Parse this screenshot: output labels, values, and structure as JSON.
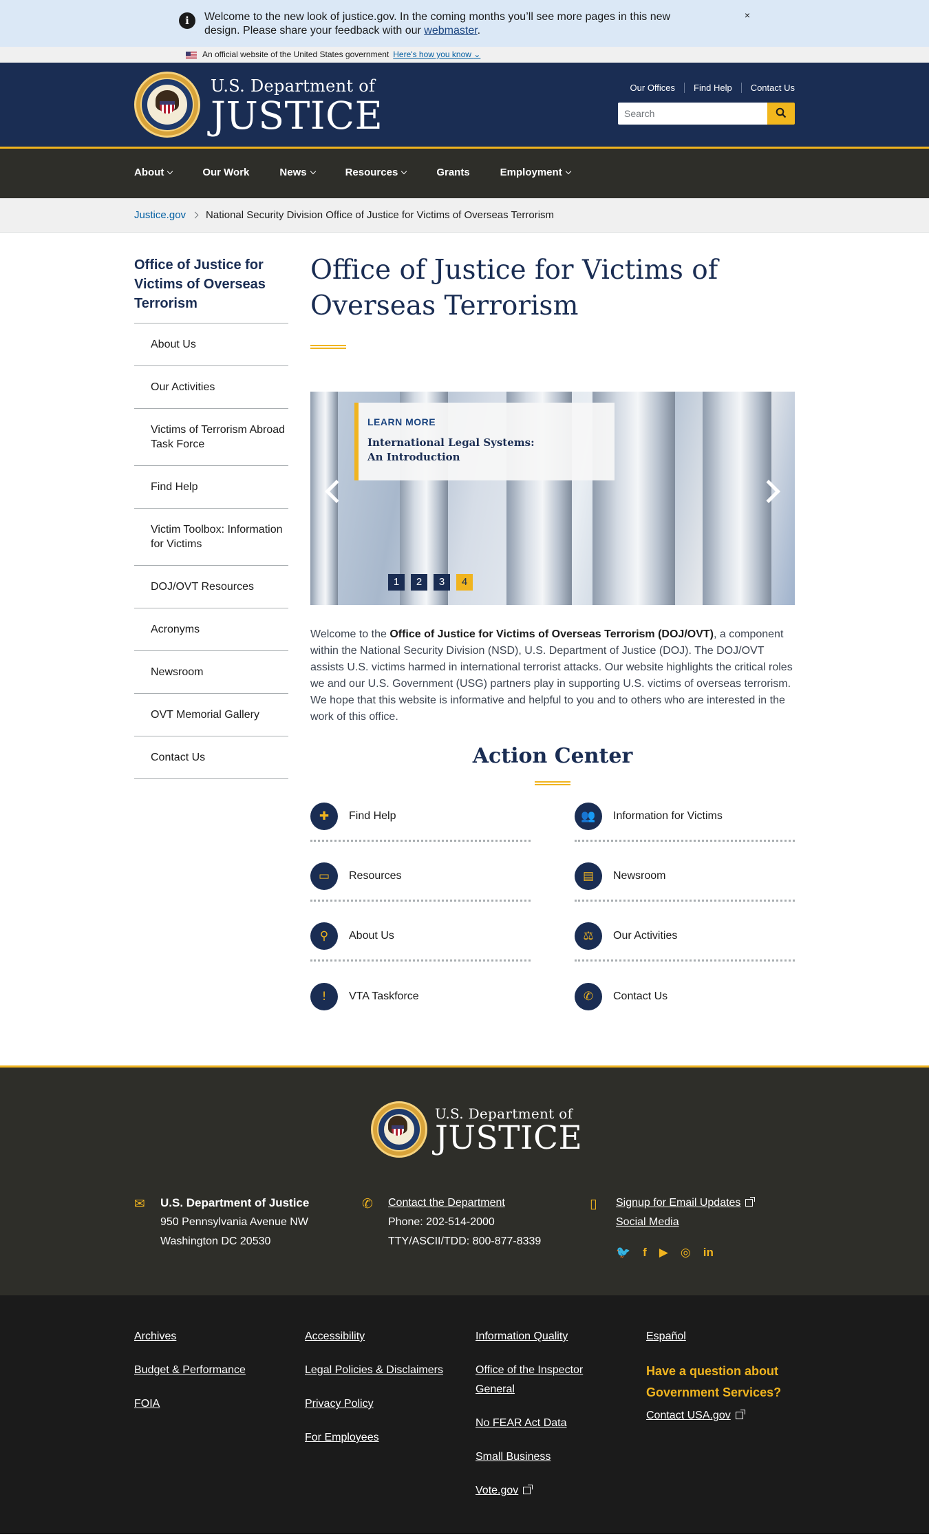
{
  "alert": {
    "message_before": "Welcome to the new look of justice.gov. In the coming months you’ll see more pages in this new design. Please share your feedback with our ",
    "link": "webmaster",
    "message_after": ".",
    "close": "×"
  },
  "gov_banner": {
    "text": "An official website of the United States government",
    "how_link": "Here's how you know"
  },
  "header": {
    "subtitle": "U.S. Department of",
    "title": "JUSTICE",
    "utility": [
      "Our Offices",
      "Find Help",
      "Contact Us"
    ],
    "search_placeholder": "Search"
  },
  "nav": [
    {
      "label": "About",
      "has_menu": true
    },
    {
      "label": "Our Work",
      "has_menu": false
    },
    {
      "label": "News",
      "has_menu": true
    },
    {
      "label": "Resources",
      "has_menu": true
    },
    {
      "label": "Grants",
      "has_menu": false
    },
    {
      "label": "Employment",
      "has_menu": true
    }
  ],
  "breadcrumb": {
    "home": "Justice.gov",
    "current": "National Security Division Office of Justice for Victims of Overseas Terrorism"
  },
  "sidenav": {
    "title": "Office of Justice for Victims of Overseas Terrorism",
    "items": [
      "About Us",
      "Our Activities",
      "Victims of Terrorism Abroad Task Force",
      "Find Help",
      "Victim Toolbox: Information for Victims",
      "DOJ/OVT Resources",
      "Acronyms",
      "Newsroom",
      "OVT Memorial Gallery",
      "Contact Us"
    ]
  },
  "main": {
    "title": "Office of Justice for Victims of Overseas Terrorism",
    "carousel": {
      "kicker": "LEARN MORE",
      "caption": "International Legal Systems: An Introduction",
      "slides": [
        "1",
        "2",
        "3",
        "4"
      ],
      "active_slide": "4"
    },
    "intro": {
      "before": "Welcome to the ",
      "bold": "Office of Justice for Victims of Overseas Terrorism (DOJ/OVT)",
      "after": ", a component within the National Security Division (NSD), U.S. Department of Justice (DOJ). The DOJ/OVT assists U.S. victims harmed in international terrorist attacks. Our website highlights the critical roles we and our U.S. Government (USG) partners play in supporting U.S. victims of overseas terrorism. We hope that this website is informative and helpful to you and to others who are interested in the work of this office."
    },
    "action_center": {
      "title": "Action Center",
      "items": [
        {
          "label": "Find Help",
          "icon": "medkit-icon"
        },
        {
          "label": "Information for Victims",
          "icon": "people-icon"
        },
        {
          "label": "Resources",
          "icon": "monitor-icon"
        },
        {
          "label": "Newsroom",
          "icon": "book-icon"
        },
        {
          "label": "About Us",
          "icon": "search-icon"
        },
        {
          "label": "Our Activities",
          "icon": "scales-icon"
        },
        {
          "label": "VTA Taskforce",
          "icon": "alert-icon"
        },
        {
          "label": "Contact Us",
          "icon": "phone-icon"
        }
      ]
    }
  },
  "footer": {
    "subtitle": "U.S. Department of",
    "title": "JUSTICE",
    "address": {
      "name": "U.S. Department of Justice",
      "line1": "950 Pennsylvania Avenue NW",
      "line2": "Washington DC 20530"
    },
    "contact": {
      "link": "Contact the Department",
      "phone": "Phone: 202-514-2000",
      "tty": "TTY/ASCII/TDD: 800-877-8339"
    },
    "updates": {
      "email": "Signup for Email Updates",
      "social": "Social Media"
    },
    "social_icons": [
      "twitter-icon",
      "facebook-icon",
      "youtube-icon",
      "instagram-icon",
      "linkedin-icon"
    ],
    "links_col1": [
      "Archives",
      "Budget & Performance",
      "FOIA"
    ],
    "links_col2": [
      "Accessibility",
      "Legal Policies & Disclaimers",
      "Privacy Policy",
      "For Employees"
    ],
    "links_col3": [
      "Information Quality",
      "Office of the Inspector General",
      "No FEAR Act Data",
      "Small Business",
      "Vote.gov"
    ],
    "links_col4": {
      "espanol": "Español",
      "question": "Have a question about Government Services?",
      "usa": "Contact USA.gov"
    },
    "colors": {
      "navy": "#1a2d53",
      "gold": "#f0b41f",
      "charcoal": "#2e2e29"
    }
  }
}
